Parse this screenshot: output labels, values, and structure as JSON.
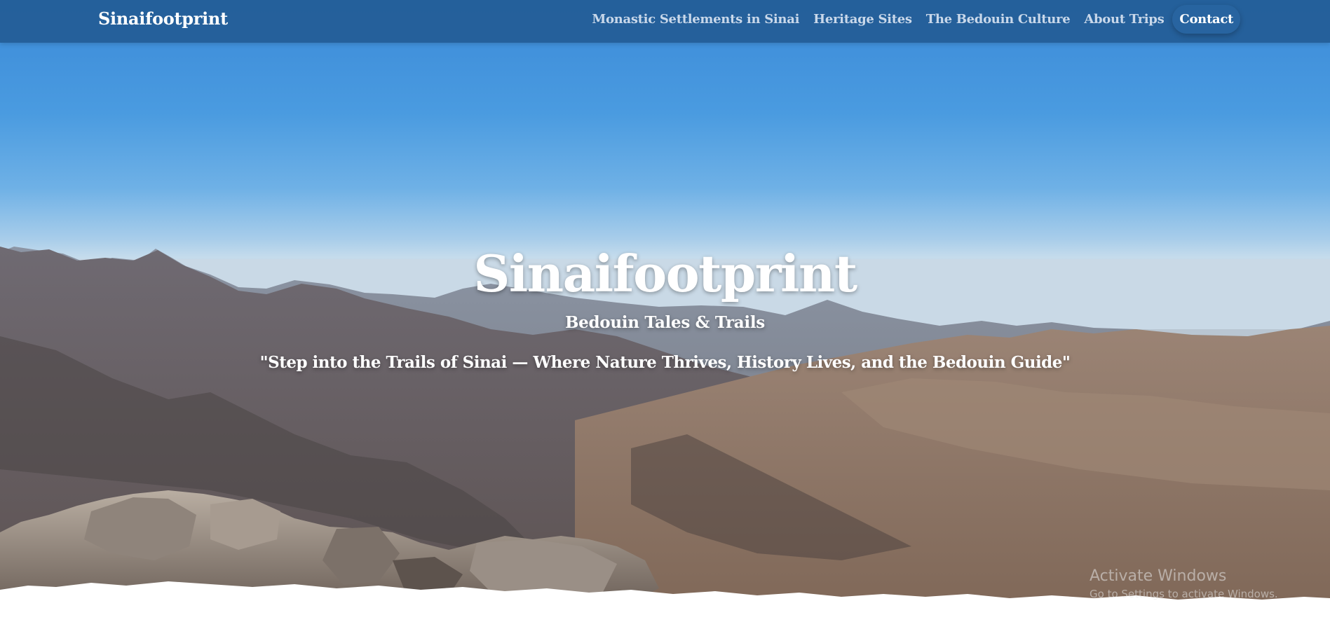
{
  "nav": {
    "brand": "Sinaifootprint",
    "links": [
      {
        "label": "Monastic Settlements in Sinai"
      },
      {
        "label": "Heritage Sites"
      },
      {
        "label": "The Bedouin Culture"
      },
      {
        "label": "About Trips"
      },
      {
        "label": "Contact"
      }
    ]
  },
  "hero": {
    "title": "Sinaifootprint",
    "subtitle": "Bedouin Tales & Trails",
    "quote": "\"Step into the Trails of Sinai — Where Nature Thrives, History Lives, and the Bedouin Guide\""
  },
  "watermark": {
    "title": "Activate Windows",
    "subtitle": "Go to Settings to activate Windows."
  },
  "colors": {
    "navbar": "#235c96",
    "sky_top": "#3b8ad8",
    "text": "#ffffff"
  }
}
